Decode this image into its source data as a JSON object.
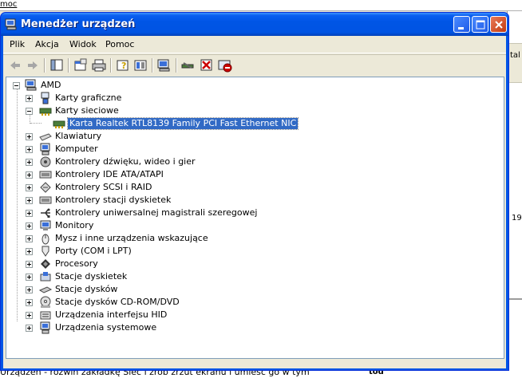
{
  "background": {
    "top_text": "moc",
    "right_text_1": "tal",
    "right_text_2": "19",
    "bottom_text": "Urządzeń - rozwiń zakładkę Sieć i zrób zrzut ekranu i umieść go w tym",
    "bottom_right_text": "tód"
  },
  "window": {
    "title": "Menedżer urządzeń",
    "menu": [
      "Plik",
      "Akcja",
      "Widok",
      "Pomoc"
    ]
  },
  "tree": {
    "root": "AMD",
    "categories": [
      {
        "label": "Karty graficzne",
        "icon": "display-adapter-icon",
        "expanded": false
      },
      {
        "label": "Karty sieciowe",
        "icon": "network-adapter-icon",
        "expanded": true,
        "children": [
          {
            "label": "Karta Realtek RTL8139 Family PCI Fast Ethernet NIC",
            "icon": "network-card-icon",
            "selected": true
          }
        ]
      },
      {
        "label": "Klawiatury",
        "icon": "keyboard-icon",
        "expanded": false
      },
      {
        "label": "Komputer",
        "icon": "computer-icon",
        "expanded": false
      },
      {
        "label": "Kontrolery dźwięku, wideo i gier",
        "icon": "sound-icon",
        "expanded": false
      },
      {
        "label": "Kontrolery IDE ATA/ATAPI",
        "icon": "ide-controller-icon",
        "expanded": false
      },
      {
        "label": "Kontrolery SCSI i RAID",
        "icon": "scsi-icon",
        "expanded": false
      },
      {
        "label": "Kontrolery stacji dyskietek",
        "icon": "floppy-controller-icon",
        "expanded": false
      },
      {
        "label": "Kontrolery uniwersalnej magistrali szeregowej",
        "icon": "usb-icon",
        "expanded": false
      },
      {
        "label": "Monitory",
        "icon": "monitor-icon",
        "expanded": false
      },
      {
        "label": "Mysz i inne urządzenia wskazujące",
        "icon": "mouse-icon",
        "expanded": false
      },
      {
        "label": "Porty (COM i LPT)",
        "icon": "port-icon",
        "expanded": false
      },
      {
        "label": "Procesory",
        "icon": "processor-icon",
        "expanded": false
      },
      {
        "label": "Stacje dyskietek",
        "icon": "floppy-drive-icon",
        "expanded": false
      },
      {
        "label": "Stacje dysków",
        "icon": "disk-drive-icon",
        "expanded": false
      },
      {
        "label": "Stacje dysków CD-ROM/DVD",
        "icon": "cdrom-icon",
        "expanded": false
      },
      {
        "label": "Urządzenia interfejsu HID",
        "icon": "hid-icon",
        "expanded": false
      },
      {
        "label": "Urządzenia systemowe",
        "icon": "system-devices-icon",
        "expanded": false
      }
    ]
  },
  "colors": {
    "titlebar": "#0055e5",
    "selection": "#316ac5",
    "window_bg": "#ece9d8"
  }
}
